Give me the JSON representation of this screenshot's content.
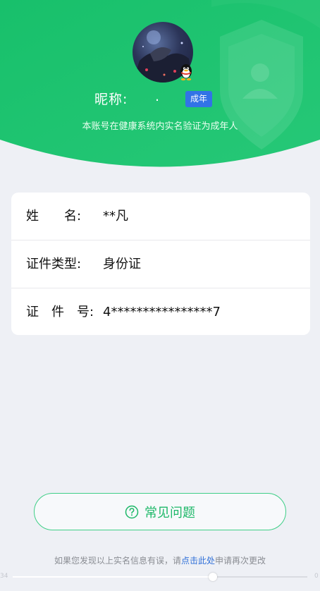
{
  "profile": {
    "nickname_label": "昵称:",
    "nickname_value": ".",
    "age_badge": "成年",
    "verify_note": "本账号在健康系统内实名验证为成年人",
    "avatar_icon": "avatar",
    "qq_icon": "qq-penguin-icon"
  },
  "info": {
    "rows": [
      {
        "label": "姓　　名:",
        "value": "**凡"
      },
      {
        "label": "证件类型:",
        "value": "身份证"
      },
      {
        "label": "证　件　号:",
        "value": "4****************7"
      }
    ]
  },
  "faq": {
    "label": "常见问题",
    "icon": "question-circle-icon"
  },
  "footer": {
    "prefix": "如果您发现以上实名信息有误，请",
    "link": "点击此处",
    "suffix": "申请再次更改"
  },
  "scrubber": {
    "start_text": "34",
    "end_text": "0",
    "progress": 0.68
  },
  "colors": {
    "header_green": "#1ec36f",
    "accent_green": "#1db868",
    "badge_blue": "#3273e6",
    "link_blue": "#2f6fd8",
    "page_bg": "#eef0f5"
  }
}
